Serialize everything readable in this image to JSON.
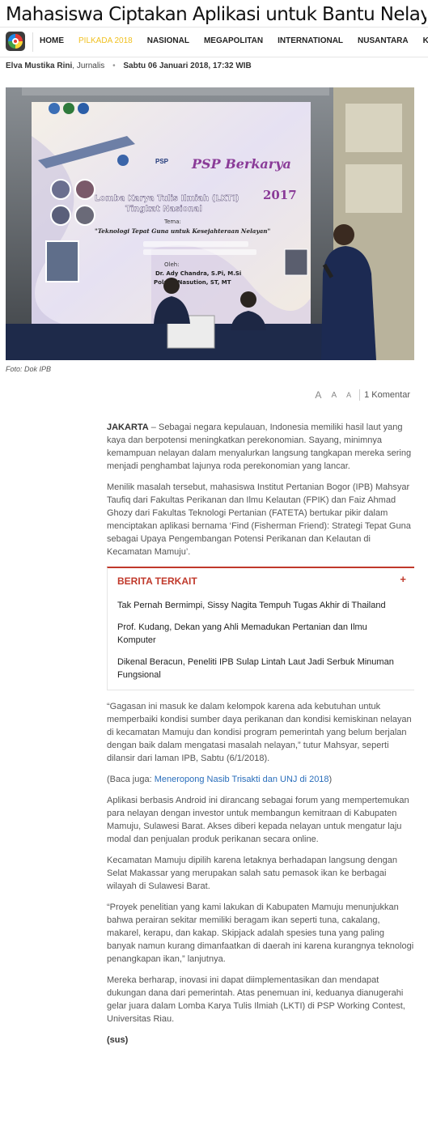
{
  "article": {
    "headline": "Mahasiswa Ciptakan Aplikasi untuk Bantu Nelayan",
    "author": "Elva Mustika Rini",
    "author_role": "Jurnalis",
    "bullet": "•",
    "date": "Sabtu 06 Januari 2018, 17:32 WIB",
    "photo_caption": "Foto: Dok IPB",
    "signoff": "(sus)"
  },
  "nav": {
    "items": [
      "HOME",
      "PILKADA 2018",
      "NASIONAL",
      "MEGAPOLITAN",
      "INTERNATIONAL",
      "NUSANTARA",
      "KAMPUS"
    ]
  },
  "photo": {
    "logos": [
      "PSP"
    ],
    "banner_title": "PSP Berkarya",
    "banner_year": "2017",
    "banner_line1": "Lomba Karya Tulis Ilmiah (LKTI)",
    "banner_line2": "Tingkat Nasional",
    "banner_tema": "Tema:",
    "banner_theme": "\"Teknologi Tepat Guna untuk Kesejahteraan Nelayan\"",
    "banner_oleh": "Oleh:",
    "banner_speaker1": "Dr. Ady Chandra, S.Pi, M.Si",
    "banner_speaker2": "Polaris Nasution, ST, MT"
  },
  "tools": {
    "font_large": "A",
    "font_medium": "A",
    "font_small": "A",
    "comments": "1 Komentar"
  },
  "body": {
    "p1_lead": "JAKARTA",
    "p1": " – Sebagai negara kepulauan, Indonesia memiliki hasil laut yang kaya dan berpotensi meningkatkan perekonomian. Sayang, minimnya kemampuan nelayan dalam menyalurkan langsung tangkapan mereka sering menjadi penghambat lajunya roda perekonomian yang lancar.",
    "p2": "Menilik masalah tersebut, mahasiswa Institut Pertanian Bogor (IPB) Mahsyar Taufiq dari Fakultas Perikanan dan Ilmu Kelautan (FPIK) dan Faiz Ahmad Ghozy dari Fakultas Teknologi Pertanian (FATETA) bertukar pikir dalam menciptakan aplikasi bernama ‘Find (Fisherman Friend): Strategi Tepat Guna sebagai Upaya Pengembangan Potensi Perikanan dan Kelautan di Kecamatan Mamuju’.",
    "p3": "“Gagasan ini masuk ke dalam kelompok karena ada kebutuhan untuk memperbaiki kondisi sumber daya perikanan dan kondisi kemiskinan nelayan di kecamatan Mamuju dan kondisi program pemerintah yang belum berjalan dengan baik dalam mengatasi masalah nelayan,” tutur Mahsyar, seperti dilansir dari laman IPB, Sabtu (6/1/2018).",
    "p4_prefix": "(Baca juga: ",
    "p4_link": "Meneropong Nasib Trisakti dan UNJ di 2018",
    "p4_suffix": ")",
    "p5": "Aplikasi berbasis Android ini dirancang sebagai forum yang mempertemukan para nelayan dengan investor untuk membangun kemitraan di Kabupaten Mamuju, Sulawesi Barat. Akses diberi kepada nelayan untuk mengatur laju modal dan penjualan produk perikanan secara online.",
    "p6": "Kecamatan Mamuju dipilih karena letaknya berhadapan langsung dengan Selat Makassar yang merupakan salah satu pemasok ikan ke berbagai wilayah di Sulawesi Barat.",
    "p7": "“Proyek penelitian yang kami lakukan di Kabupaten Mamuju menunjukkan bahwa perairan sekitar memiliki beragam ikan seperti tuna, cakalang, makarel, kerapu, dan kakap. Skipjack adalah spesies tuna yang paling banyak namun kurang dimanfaatkan di daerah ini karena kurangnya teknologi penangkapan ikan,” lanjutnya.",
    "p8": "Mereka berharap, inovasi ini dapat diimplementasikan dan mendapat dukungan dana dari pemerintah. Atas penemuan ini, keduanya dianugerahi gelar juara dalam Lomba Karya Tulis Ilmiah (LKTI) di PSP Working Contest, Universitas Riau."
  },
  "related": {
    "title": "BERITA TERKAIT",
    "toggle": "+",
    "items": [
      "Tak Pernah Bermimpi, Sissy Nagita Tempuh Tugas Akhir di Thailand",
      "Prof. Kudang, Dekan yang Ahli Memadukan Pertanian dan Ilmu Komputer",
      "Dikenal Beracun, Peneliti IPB Sulap Lintah Laut Jadi Serbuk Minuman Fungsional"
    ]
  },
  "colors": {
    "accent_red": "#c0392b",
    "pilkada_yellow": "#f0c020",
    "link_blue": "#2a6ebb"
  }
}
